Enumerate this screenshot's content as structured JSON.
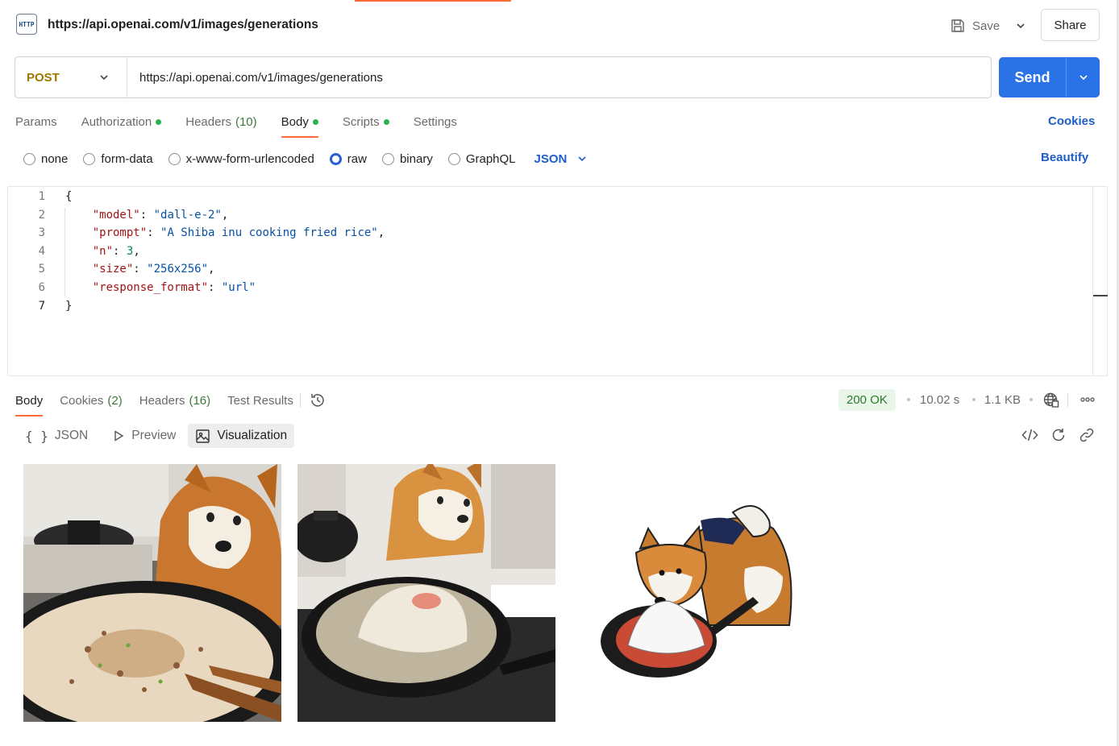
{
  "header": {
    "icon_text": "HTTP",
    "title": "https://api.openai.com/v1/images/generations",
    "save_label": "Save",
    "share_label": "Share"
  },
  "request": {
    "method": "POST",
    "url": "https://api.openai.com/v1/images/generations",
    "send_label": "Send"
  },
  "tabs": [
    {
      "label": "Params",
      "count": "",
      "dot": false,
      "active": false
    },
    {
      "label": "Authorization",
      "count": "",
      "dot": true,
      "active": false
    },
    {
      "label": "Headers",
      "count": "(10)",
      "dot": false,
      "active": false
    },
    {
      "label": "Body",
      "count": "",
      "dot": true,
      "active": true
    },
    {
      "label": "Scripts",
      "count": "",
      "dot": true,
      "active": false
    },
    {
      "label": "Settings",
      "count": "",
      "dot": false,
      "active": false
    }
  ],
  "cookies_label": "Cookies",
  "body_types": [
    {
      "label": "none",
      "selected": false
    },
    {
      "label": "form-data",
      "selected": false
    },
    {
      "label": "x-www-form-urlencoded",
      "selected": false
    },
    {
      "label": "raw",
      "selected": true
    },
    {
      "label": "binary",
      "selected": false
    },
    {
      "label": "GraphQL",
      "selected": false
    }
  ],
  "raw_format": "JSON",
  "beautify_label": "Beautify",
  "code_lines": [
    {
      "num": "1",
      "text": "{"
    },
    {
      "num": "2",
      "text": "    \"model\": \"dall-e-2\","
    },
    {
      "num": "3",
      "text": "    \"prompt\": \"A Shiba inu cooking fried rice\","
    },
    {
      "num": "4",
      "text": "    \"n\": 3,"
    },
    {
      "num": "5",
      "text": "    \"size\": \"256x256\","
    },
    {
      "num": "6",
      "text": "    \"response_format\": \"url\""
    },
    {
      "num": "7",
      "text": "}"
    }
  ],
  "response": {
    "tabs": [
      {
        "label": "Body",
        "count": "",
        "active": true
      },
      {
        "label": "Cookies",
        "count": "(2)",
        "active": false
      },
      {
        "label": "Headers",
        "count": "(16)",
        "active": false
      },
      {
        "label": "Test Results",
        "count": "",
        "active": false
      }
    ],
    "status": "200 OK",
    "time": "10.02 s",
    "size": "1.1 KB",
    "views": [
      {
        "label": "JSON",
        "icon": "braces-icon",
        "active": false
      },
      {
        "label": "Preview",
        "icon": "play-icon",
        "active": false
      },
      {
        "label": "Visualization",
        "icon": "image-icon",
        "active": true
      }
    ]
  },
  "colors": {
    "accent": "#ff6c37",
    "send": "#2a73e6",
    "link": "#1f5dc9",
    "method": "#a07700",
    "status_bg": "#eaf6ea",
    "status_fg": "#2b7a2b"
  }
}
